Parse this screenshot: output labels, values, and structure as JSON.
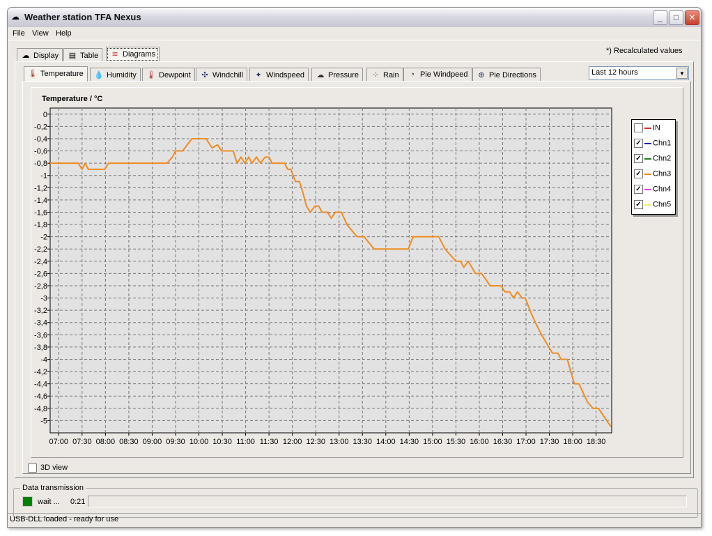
{
  "window": {
    "title": "Weather station TFA Nexus",
    "min": "_",
    "max": "□",
    "close": "✕"
  },
  "menu": [
    "File",
    "View",
    "Help"
  ],
  "main_tabs": [
    {
      "label": "Display",
      "icon": "cloud-icon"
    },
    {
      "label": "Table",
      "icon": "table-icon"
    },
    {
      "label": "Diagrams",
      "icon": "chart-icon"
    }
  ],
  "note": "*) Recalculated values",
  "sub_tabs": [
    {
      "label": "Temperature",
      "icon": "thermometer-icon"
    },
    {
      "label": "Humidity",
      "icon": "drops-icon"
    },
    {
      "label": "Dewpoint",
      "icon": "dewpoint-icon"
    },
    {
      "label": "Windchill",
      "icon": "windchill-icon"
    },
    {
      "label": "Windspeed",
      "icon": "compass-icon"
    },
    {
      "label": "Pressure",
      "icon": "cloud-icon"
    },
    {
      "label": "Rain",
      "icon": "rain-icon"
    },
    {
      "label": "Pie Windpeed",
      "icon": "pie-icon"
    },
    {
      "label": "Pie Directions",
      "icon": "globe-icon"
    }
  ],
  "range_select": "Last 12 hours",
  "view3d_label": "3D view",
  "transmission": {
    "group": "Data transmission",
    "status": "wait ...",
    "time": "0:21",
    "progress": 0,
    "indicator_color": "#008000"
  },
  "statusbar": "USB-DLL loaded - ready for use",
  "legend": [
    {
      "name": "IN",
      "color": "#d03030",
      "checked": false
    },
    {
      "name": "Chn1",
      "color": "#1a1aa0",
      "checked": true
    },
    {
      "name": "Chn2",
      "color": "#208020",
      "checked": true
    },
    {
      "name": "Chn3",
      "color": "#f08c20",
      "checked": true
    },
    {
      "name": "Chn4",
      "color": "#e040e0",
      "checked": true
    },
    {
      "name": "Chn5",
      "color": "#f0f060",
      "checked": true
    }
  ],
  "chart_data": {
    "type": "line",
    "title": "Temperature / °C",
    "xlabel": "",
    "ylabel": "Temperature / °C",
    "xlim": [
      "06:49",
      "18:50"
    ],
    "ylim": [
      -5.2,
      0.1
    ],
    "grid": true,
    "legend_position": "right",
    "xticks": [
      "07:00",
      "07:30",
      "08:00",
      "08:30",
      "09:00",
      "09:30",
      "10:00",
      "10:30",
      "11:00",
      "11:30",
      "12:00",
      "12:30",
      "13:00",
      "13:30",
      "14:00",
      "14:30",
      "15:00",
      "15:30",
      "16:00",
      "16:30",
      "17:00",
      "17:30",
      "18:00",
      "18:30"
    ],
    "yticks": [
      "0",
      "-0,2",
      "-0,4",
      "-0,6",
      "-0,8",
      "-1",
      "-1,2",
      "-1,4",
      "-1,6",
      "-1,8",
      "-2",
      "-2,2",
      "-2,4",
      "-2,6",
      "-2,8",
      "-3",
      "-3,2",
      "-3,4",
      "-3,6",
      "-3,8",
      "-4",
      "-4,2",
      "-4,4",
      "-4,6",
      "-4,8",
      "-5"
    ],
    "series": [
      {
        "name": "Chn3",
        "color": "#f08c20",
        "points": [
          [
            "06:49",
            -0.8
          ],
          [
            "07:25",
            -0.8
          ],
          [
            "07:30",
            -0.9
          ],
          [
            "07:34",
            -0.8
          ],
          [
            "07:38",
            -0.9
          ],
          [
            "07:59",
            -0.9
          ],
          [
            "08:04",
            -0.8
          ],
          [
            "09:19",
            -0.8
          ],
          [
            "09:26",
            -0.7
          ],
          [
            "09:30",
            -0.6
          ],
          [
            "09:39",
            -0.6
          ],
          [
            "09:51",
            -0.4
          ],
          [
            "10:09",
            -0.4
          ],
          [
            "10:17",
            -0.55
          ],
          [
            "10:24",
            -0.5
          ],
          [
            "10:29",
            -0.6
          ],
          [
            "10:44",
            -0.6
          ],
          [
            "10:49",
            -0.8
          ],
          [
            "10:54",
            -0.7
          ],
          [
            "10:59",
            -0.8
          ],
          [
            "11:04",
            -0.7
          ],
          [
            "11:08",
            -0.8
          ],
          [
            "11:14",
            -0.7
          ],
          [
            "11:19",
            -0.8
          ],
          [
            "11:25",
            -0.7
          ],
          [
            "11:30",
            -0.7
          ],
          [
            "11:34",
            -0.8
          ],
          [
            "11:50",
            -0.8
          ],
          [
            "11:54",
            -0.9
          ],
          [
            "11:58",
            -0.9
          ],
          [
            "12:04",
            -1.1
          ],
          [
            "12:09",
            -1.1
          ],
          [
            "12:14",
            -1.3
          ],
          [
            "12:18",
            -1.5
          ],
          [
            "12:23",
            -1.6
          ],
          [
            "12:29",
            -1.5
          ],
          [
            "12:34",
            -1.5
          ],
          [
            "12:38",
            -1.6
          ],
          [
            "12:45",
            -1.6
          ],
          [
            "12:50",
            -1.7
          ],
          [
            "12:55",
            -1.6
          ],
          [
            "13:03",
            -1.6
          ],
          [
            "13:10",
            -1.8
          ],
          [
            "13:23",
            -2.0
          ],
          [
            "13:32",
            -2.0
          ],
          [
            "13:45",
            -2.2
          ],
          [
            "14:29",
            -2.2
          ],
          [
            "14:35",
            -2.0
          ],
          [
            "15:08",
            -2.0
          ],
          [
            "15:16",
            -2.2
          ],
          [
            "15:30",
            -2.4
          ],
          [
            "15:36",
            -2.4
          ],
          [
            "15:40",
            -2.5
          ],
          [
            "15:46",
            -2.4
          ],
          [
            "15:55",
            -2.6
          ],
          [
            "16:03",
            -2.6
          ],
          [
            "16:14",
            -2.8
          ],
          [
            "16:28",
            -2.8
          ],
          [
            "16:33",
            -2.9
          ],
          [
            "16:39",
            -2.9
          ],
          [
            "16:44",
            -3.0
          ],
          [
            "16:49",
            -2.9
          ],
          [
            "16:55",
            -3.0
          ],
          [
            "16:59",
            -3.0
          ],
          [
            "17:05",
            -3.2
          ],
          [
            "17:12",
            -3.4
          ],
          [
            "17:20",
            -3.6
          ],
          [
            "17:34",
            -3.9
          ],
          [
            "17:41",
            -3.9
          ],
          [
            "17:45",
            -4.0
          ],
          [
            "17:53",
            -4.0
          ],
          [
            "18:02",
            -4.4
          ],
          [
            "18:08",
            -4.4
          ],
          [
            "18:19",
            -4.7
          ],
          [
            "18:26",
            -4.8
          ],
          [
            "18:33",
            -4.8
          ],
          [
            "18:49",
            -5.1
          ]
        ]
      }
    ]
  }
}
